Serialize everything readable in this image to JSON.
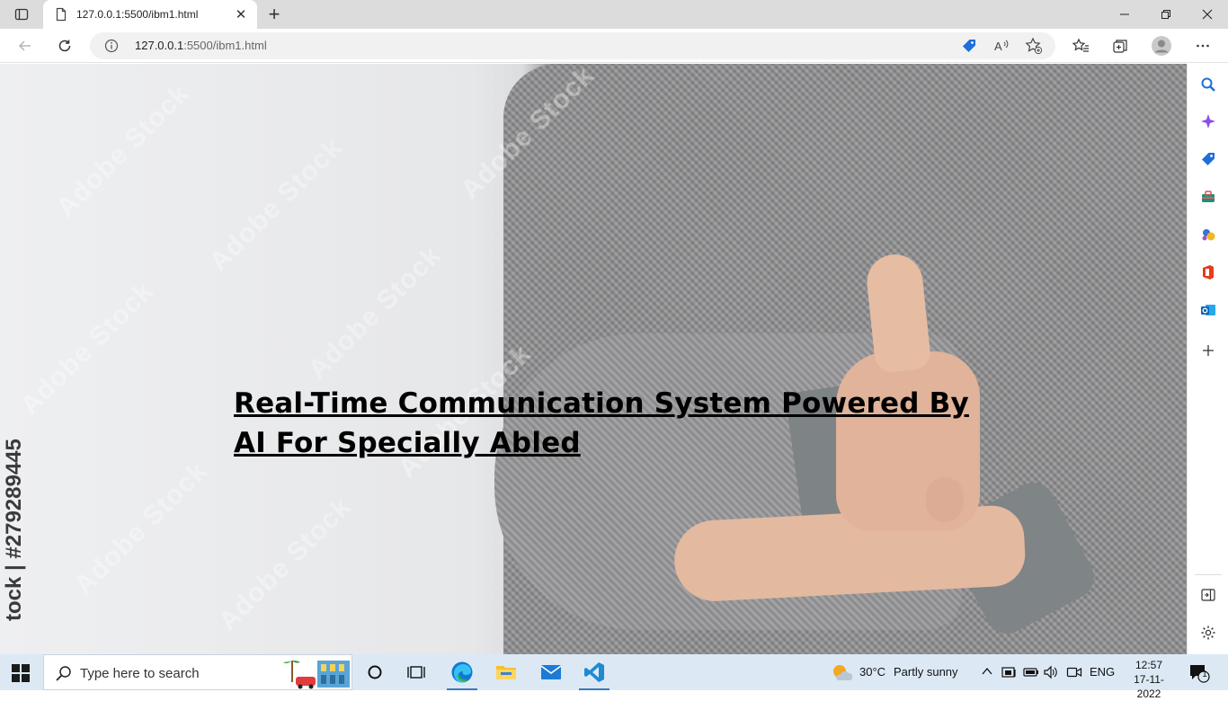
{
  "browser": {
    "tab": {
      "title": "127.0.0.1:5500/ibm1.html",
      "icon": "page-icon"
    },
    "new_tab_label": "+",
    "address": {
      "host": "127.0.0.1",
      "rest": ":5500/ibm1.html"
    }
  },
  "page": {
    "heading": "Real-Time Communication System Powered By AI For Specially Abled",
    "watermark": "Adobe Stock",
    "stock_id": "tock | #279289445"
  },
  "sidebar": {
    "items": [
      "search-icon",
      "copilot-icon",
      "shopping-tag-icon",
      "tools-icon",
      "games-icon",
      "office-icon",
      "outlook-icon",
      "add-icon"
    ],
    "bottom": [
      "hide-sidebar-icon",
      "settings-icon"
    ]
  },
  "taskbar": {
    "search_placeholder": "Type here to search",
    "weather": {
      "temp": "30°C",
      "condition": "Partly sunny"
    },
    "language": "ENG",
    "time": "12:57",
    "date": "17-11-2022",
    "notification_count": "1"
  },
  "colors": {
    "taskbar": "#dce9f5",
    "tabstrip": "#dcdcdc",
    "accent": "#3b78c4"
  }
}
